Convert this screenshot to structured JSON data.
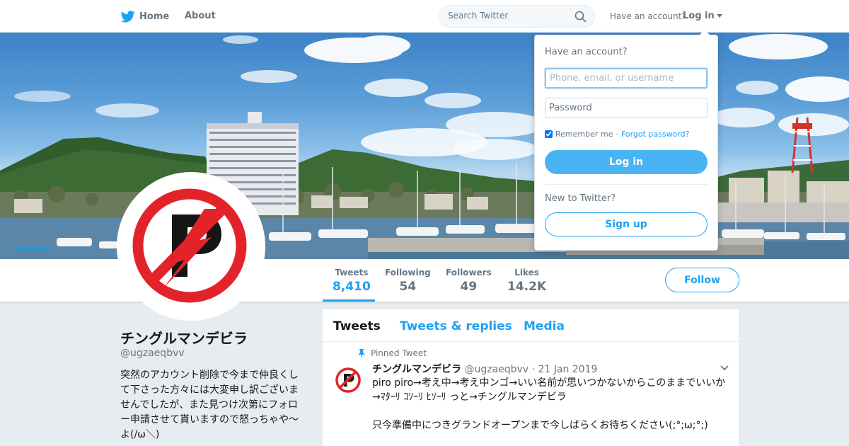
{
  "nav": {
    "home_label": "Home",
    "about_label": "About",
    "search_placeholder": "Search Twitter",
    "have_account": "Have an account?",
    "login_label": "Log in"
  },
  "profile": {
    "display_name": "チングルマンデビラ",
    "handle": "@ugzaeqbvv",
    "bio": "突然のアカウント削除で今まで仲良くして下さった方々には大変申し訳ございませんでしたが、また見つけ次第にフォロー申請させて貰いますので怒っちゃや～よ(/ω＼)"
  },
  "stats": [
    {
      "label": "Tweets",
      "value": "8,410"
    },
    {
      "label": "Following",
      "value": "54"
    },
    {
      "label": "Followers",
      "value": "49"
    },
    {
      "label": "Likes",
      "value": "14.2K"
    }
  ],
  "follow_label": "Follow",
  "tabs": [
    "Tweets",
    "Tweets & replies",
    "Media"
  ],
  "pinned_tweet": {
    "pinned_label": "Pinned Tweet",
    "name": "チングルマンデビラ",
    "handle": "@ugzaeqbvv",
    "separator": "·",
    "date": "21 Jan 2019",
    "text": "piro piro→考え中→考え中ンゴ→いい名前が思いつかないからこのままでいいか→ﾏﾀｰﾘ ｺｿｰﾘ ﾋｿｰﾘ っと→チングルマンデビラ\n\n只今準備中につきグランドオープンまで今しばらくお待ちください(;°;ω;°;)"
  },
  "login_dropdown": {
    "title": "Have an account?",
    "username_placeholder": "Phone, email, or username",
    "password_placeholder": "Password",
    "remember_label": "Remember me",
    "dot": "·",
    "forgot_label": "Forgot password?",
    "login_button": "Log in",
    "new_to_twitter": "New to Twitter?",
    "signup_button": "Sign up"
  },
  "colors": {
    "accent": "#1da1f2",
    "login_button": "#4ab3f4",
    "avatar_red": "#e3232a"
  }
}
